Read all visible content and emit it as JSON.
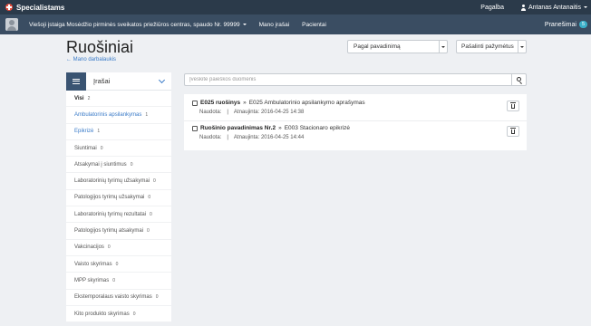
{
  "topbar": {
    "brand": "Specialistams",
    "help": "Pagalba",
    "user": "Antanas Antanaitis"
  },
  "subbar": {
    "org": "Viešoji įstaiga Mosėdžio pirminės sveikatos priežiūros centras, spaudo Nr. 99999",
    "nav": [
      "Mano įrašai",
      "Pacientai"
    ],
    "notifications_label": "Pranešimai",
    "notifications_count": "5"
  },
  "page": {
    "title": "Ruošiniai",
    "breadcrumb": "← Mano darbalaukis"
  },
  "toolbar": {
    "sort_selected": "Pagal pavadinimą",
    "delete_label": "Pašalinti pažymėtus"
  },
  "sidebar": {
    "title": "Įrašai",
    "items": [
      {
        "label": "Visi",
        "count": "2"
      },
      {
        "label": "Ambulatorinis apsilankymas",
        "count": "1"
      },
      {
        "label": "Epikrizė",
        "count": "1"
      },
      {
        "label": "Siuntimai",
        "count": "0"
      },
      {
        "label": "Atsakymai į siuntimus",
        "count": "0"
      },
      {
        "label": "Laboratorinių tyrimų užsakymai",
        "count": "0"
      },
      {
        "label": "Patologijos tyrimų užsakymai",
        "count": "0"
      },
      {
        "label": "Laboratorinių tyrimų rezultatai",
        "count": "0"
      },
      {
        "label": "Patologijos tyrimų atsakymai",
        "count": "0"
      },
      {
        "label": "Vakcinacijos",
        "count": "0"
      },
      {
        "label": "Vaisto skyrimas",
        "count": "0"
      },
      {
        "label": "MPP skyrimas",
        "count": "0"
      },
      {
        "label": "Ekstemporalaus vaisto skyrimas",
        "count": "0"
      },
      {
        "label": "Kito produkto skyrimas",
        "count": "0"
      }
    ]
  },
  "search": {
    "placeholder": "Įveskite paieškos duomenis"
  },
  "results": [
    {
      "name": "E025 ruošinys",
      "separator": "»",
      "description": "E025 Ambulatorinio apsilankymo aprašymas",
      "status": "Naudota:",
      "updated": "Atnaujinta: 2016-04-25 14:38"
    },
    {
      "name": "Ruošinio pavadinimas Nr.2",
      "separator": "»",
      "description": "E003 Stacionaro epikrizė",
      "status": "Naudota:",
      "updated": "Atnaujinta: 2016-04-25 14:44"
    }
  ],
  "colors": {
    "topbar": "#2b3a4a",
    "subbar": "#3a4d62",
    "link": "#3a7bc8",
    "badge": "#3bb0c9",
    "sidebar_button": "#3a5472"
  },
  "icons": {
    "brand": "medical-cross-icon",
    "user": "user-icon",
    "list": "list-icon",
    "chevron": "chevron-down-icon",
    "search": "search-icon",
    "delete": "trash-icon"
  }
}
